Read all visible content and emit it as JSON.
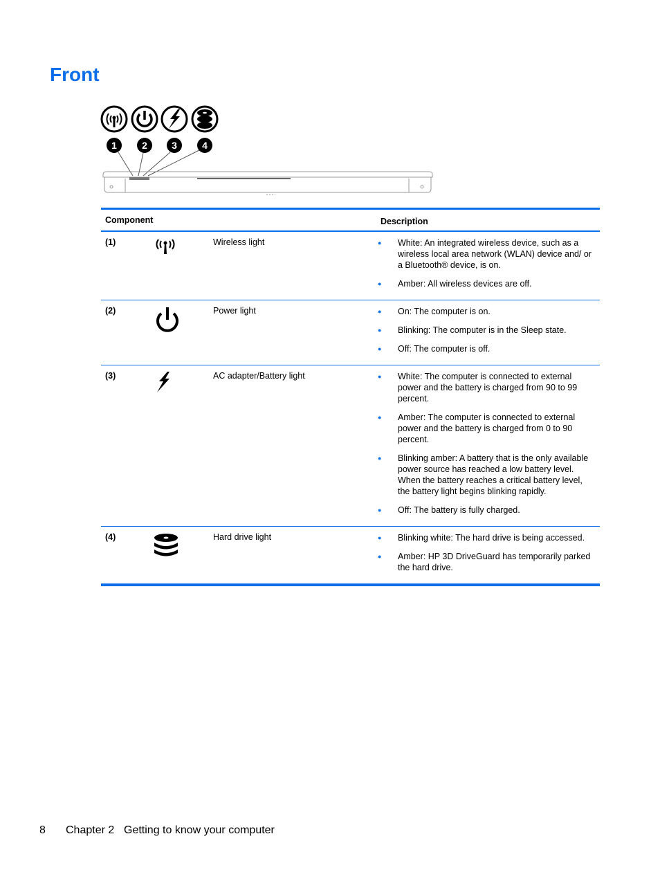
{
  "page": {
    "title": "Front"
  },
  "figure": {
    "callouts": [
      "1",
      "2",
      "3",
      "4"
    ],
    "icons": [
      "wireless-icon",
      "power-icon",
      "lightning-icon",
      "hard-drive-icon"
    ]
  },
  "table": {
    "headers": {
      "component": "Component",
      "description": "Description"
    },
    "rows": [
      {
        "num": "(1)",
        "icon": "wireless-icon",
        "name": "Wireless light",
        "bullets": [
          "White: An integrated wireless device, such as a wireless local area network (WLAN) device and/ or a Bluetooth® device, is on.",
          "Amber: All wireless devices are off."
        ]
      },
      {
        "num": "(2)",
        "icon": "power-icon",
        "name": "Power light",
        "bullets": [
          "On: The computer is on.",
          "Blinking: The computer is in the Sleep state.",
          "Off: The computer is off."
        ]
      },
      {
        "num": "(3)",
        "icon": "lightning-icon",
        "name": "AC adapter/Battery light",
        "bullets": [
          "White: The computer is connected to external power and the battery is charged from 90 to 99 percent.",
          "Amber: The computer is connected to external power and the battery is charged from 0 to 90 percent.",
          "Blinking amber: A battery that is the only available power source has reached a low battery level. When the battery reaches a critical battery level, the battery light begins blinking rapidly.",
          "Off: The battery is fully charged."
        ]
      },
      {
        "num": "(4)",
        "icon": "hard-drive-icon",
        "name": "Hard drive light",
        "bullets": [
          "Blinking white: The hard drive is being accessed.",
          "Amber: HP 3D DriveGuard has temporarily parked the hard drive."
        ]
      }
    ]
  },
  "footer": {
    "page_number": "8",
    "chapter": "Chapter 2",
    "chapter_title": "Getting to know your computer"
  },
  "colors": {
    "accent": "#0a6eea"
  }
}
